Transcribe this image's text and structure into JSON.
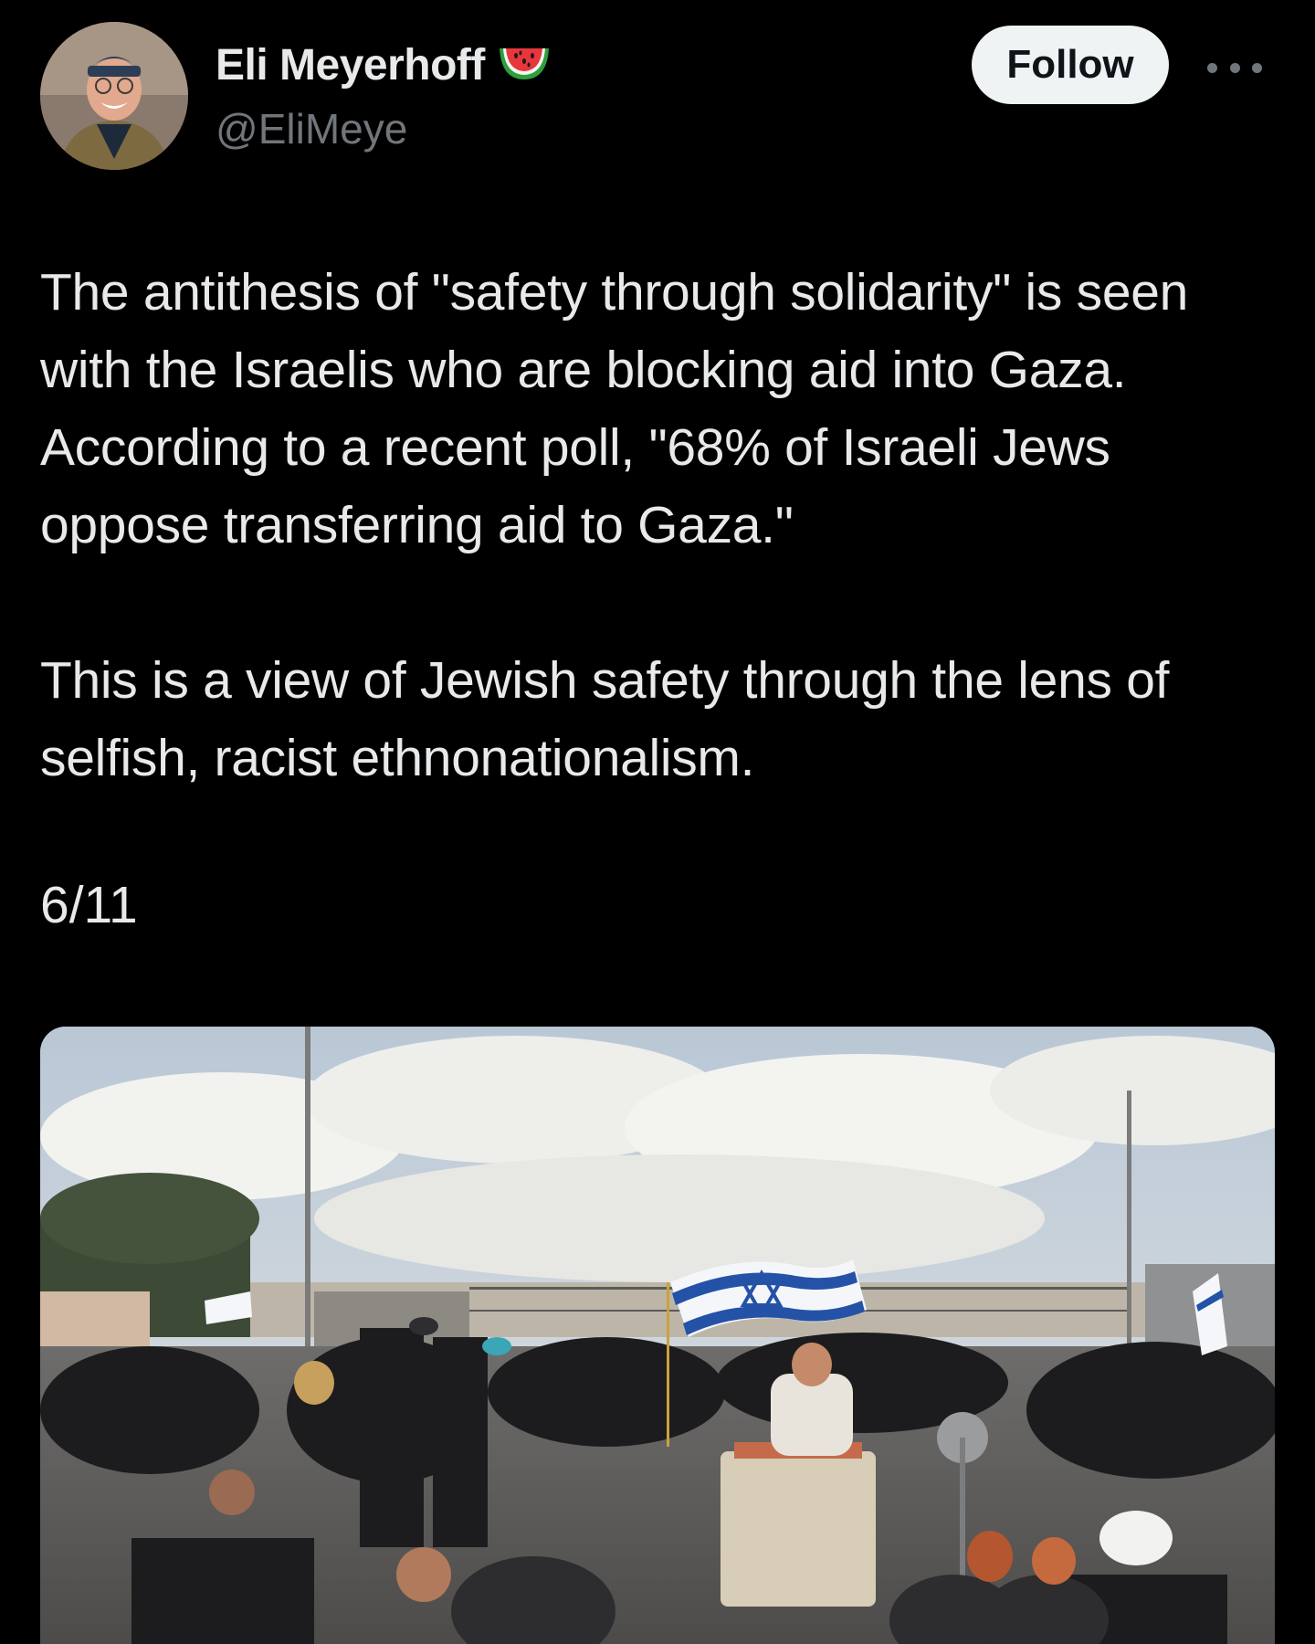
{
  "author": {
    "display_name": "Eli Meyerhoff",
    "handle": "@EliMeye",
    "badge_icon": "watermelon-icon"
  },
  "actions": {
    "follow_label": "Follow",
    "more_icon": "more-horizontal-icon"
  },
  "tweet": {
    "paragraph_1": "The antithesis of \"safety through solidarity\" is seen with the Israelis who are blocking aid into Gaza. According to a recent poll, \"68% of Israeli Jews oppose transferring aid to Gaza.\"",
    "paragraph_2": "This is a view of Jewish safety through the lens of selfish, racist ethnonationalism.",
    "thread_counter": "6/11"
  },
  "colors": {
    "background": "#000000",
    "text_primary": "#e7e9ea",
    "text_secondary": "#71767b",
    "follow_bg": "#eff3f4",
    "follow_text": "#0f1419"
  }
}
